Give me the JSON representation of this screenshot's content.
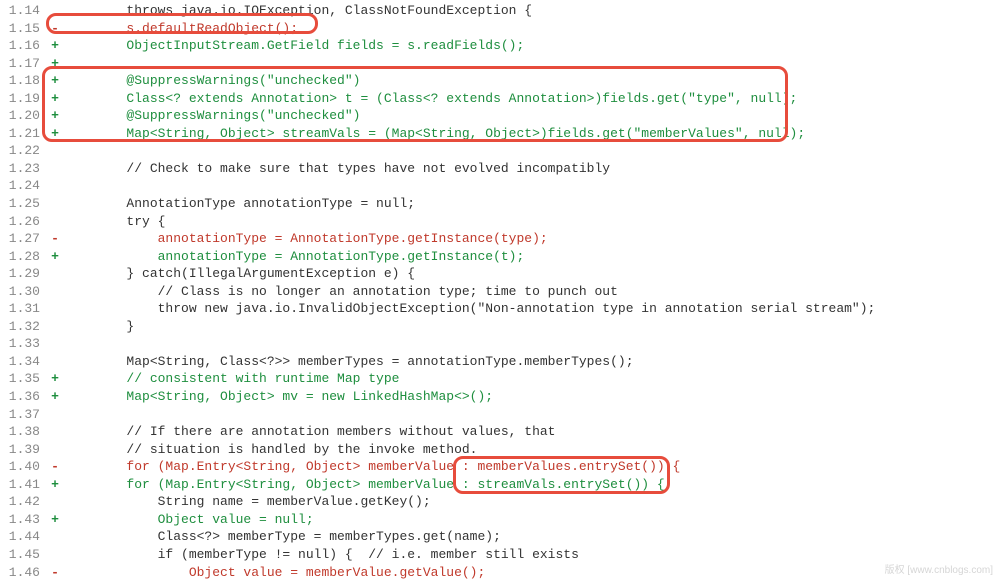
{
  "diff": {
    "lines": [
      {
        "ln": "1.14",
        "m": " ",
        "cls": "",
        "txt": "        throws java.io.IOException, ClassNotFoundException {"
      },
      {
        "ln": "1.15",
        "m": "-",
        "cls": "removed",
        "txt": "        s.defaultReadObject();"
      },
      {
        "ln": "1.16",
        "m": "+",
        "cls": "added",
        "txt": "        ObjectInputStream.GetField fields = s.readFields();"
      },
      {
        "ln": "1.17",
        "m": "+",
        "cls": "added",
        "txt": ""
      },
      {
        "ln": "1.18",
        "m": "+",
        "cls": "added",
        "txt": "        @SuppressWarnings(\"unchecked\")"
      },
      {
        "ln": "1.19",
        "m": "+",
        "cls": "added",
        "txt": "        Class<? extends Annotation> t = (Class<? extends Annotation>)fields.get(\"type\", null);"
      },
      {
        "ln": "1.20",
        "m": "+",
        "cls": "added",
        "txt": "        @SuppressWarnings(\"unchecked\")"
      },
      {
        "ln": "1.21",
        "m": "+",
        "cls": "added",
        "txt": "        Map<String, Object> streamVals = (Map<String, Object>)fields.get(\"memberValues\", null);"
      },
      {
        "ln": "1.22",
        "m": " ",
        "cls": "",
        "txt": ""
      },
      {
        "ln": "1.23",
        "m": " ",
        "cls": "",
        "txt": "        // Check to make sure that types have not evolved incompatibly"
      },
      {
        "ln": "1.24",
        "m": " ",
        "cls": "",
        "txt": ""
      },
      {
        "ln": "1.25",
        "m": " ",
        "cls": "",
        "txt": "        AnnotationType annotationType = null;"
      },
      {
        "ln": "1.26",
        "m": " ",
        "cls": "",
        "txt": "        try {"
      },
      {
        "ln": "1.27",
        "m": "-",
        "cls": "removed",
        "txt": "            annotationType = AnnotationType.getInstance(type);"
      },
      {
        "ln": "1.28",
        "m": "+",
        "cls": "added",
        "txt": "            annotationType = AnnotationType.getInstance(t);"
      },
      {
        "ln": "1.29",
        "m": " ",
        "cls": "",
        "txt": "        } catch(IllegalArgumentException e) {"
      },
      {
        "ln": "1.30",
        "m": " ",
        "cls": "",
        "txt": "            // Class is no longer an annotation type; time to punch out"
      },
      {
        "ln": "1.31",
        "m": " ",
        "cls": "",
        "txt": "            throw new java.io.InvalidObjectException(\"Non-annotation type in annotation serial stream\");"
      },
      {
        "ln": "1.32",
        "m": " ",
        "cls": "",
        "txt": "        }"
      },
      {
        "ln": "1.33",
        "m": " ",
        "cls": "",
        "txt": ""
      },
      {
        "ln": "1.34",
        "m": " ",
        "cls": "",
        "txt": "        Map<String, Class<?>> memberTypes = annotationType.memberTypes();"
      },
      {
        "ln": "1.35",
        "m": "+",
        "cls": "added",
        "txt": "        // consistent with runtime Map type"
      },
      {
        "ln": "1.36",
        "m": "+",
        "cls": "added",
        "txt": "        Map<String, Object> mv = new LinkedHashMap<>();"
      },
      {
        "ln": "1.37",
        "m": " ",
        "cls": "",
        "txt": ""
      },
      {
        "ln": "1.38",
        "m": " ",
        "cls": "",
        "txt": "        // If there are annotation members without values, that"
      },
      {
        "ln": "1.39",
        "m": " ",
        "cls": "",
        "txt": "        // situation is handled by the invoke method."
      },
      {
        "ln": "1.40",
        "m": "-",
        "cls": "removed",
        "txt": "        for (Map.Entry<String, Object> memberValue : memberValues.entrySet()) {"
      },
      {
        "ln": "1.41",
        "m": "+",
        "cls": "added",
        "txt": "        for (Map.Entry<String, Object> memberValue : streamVals.entrySet()) {"
      },
      {
        "ln": "1.42",
        "m": " ",
        "cls": "",
        "txt": "            String name = memberValue.getKey();"
      },
      {
        "ln": "1.43",
        "m": "+",
        "cls": "added",
        "txt": "            Object value = null;"
      },
      {
        "ln": "1.44",
        "m": " ",
        "cls": "",
        "txt": "            Class<?> memberType = memberTypes.get(name);"
      },
      {
        "ln": "1.45",
        "m": " ",
        "cls": "",
        "txt": "            if (memberType != null) {  // i.e. member still exists"
      },
      {
        "ln": "1.46",
        "m": "-",
        "cls": "removed",
        "txt": "                Object value = memberValue.getValue();"
      }
    ]
  },
  "watermark": "版权 [www.cnblogs.com]"
}
